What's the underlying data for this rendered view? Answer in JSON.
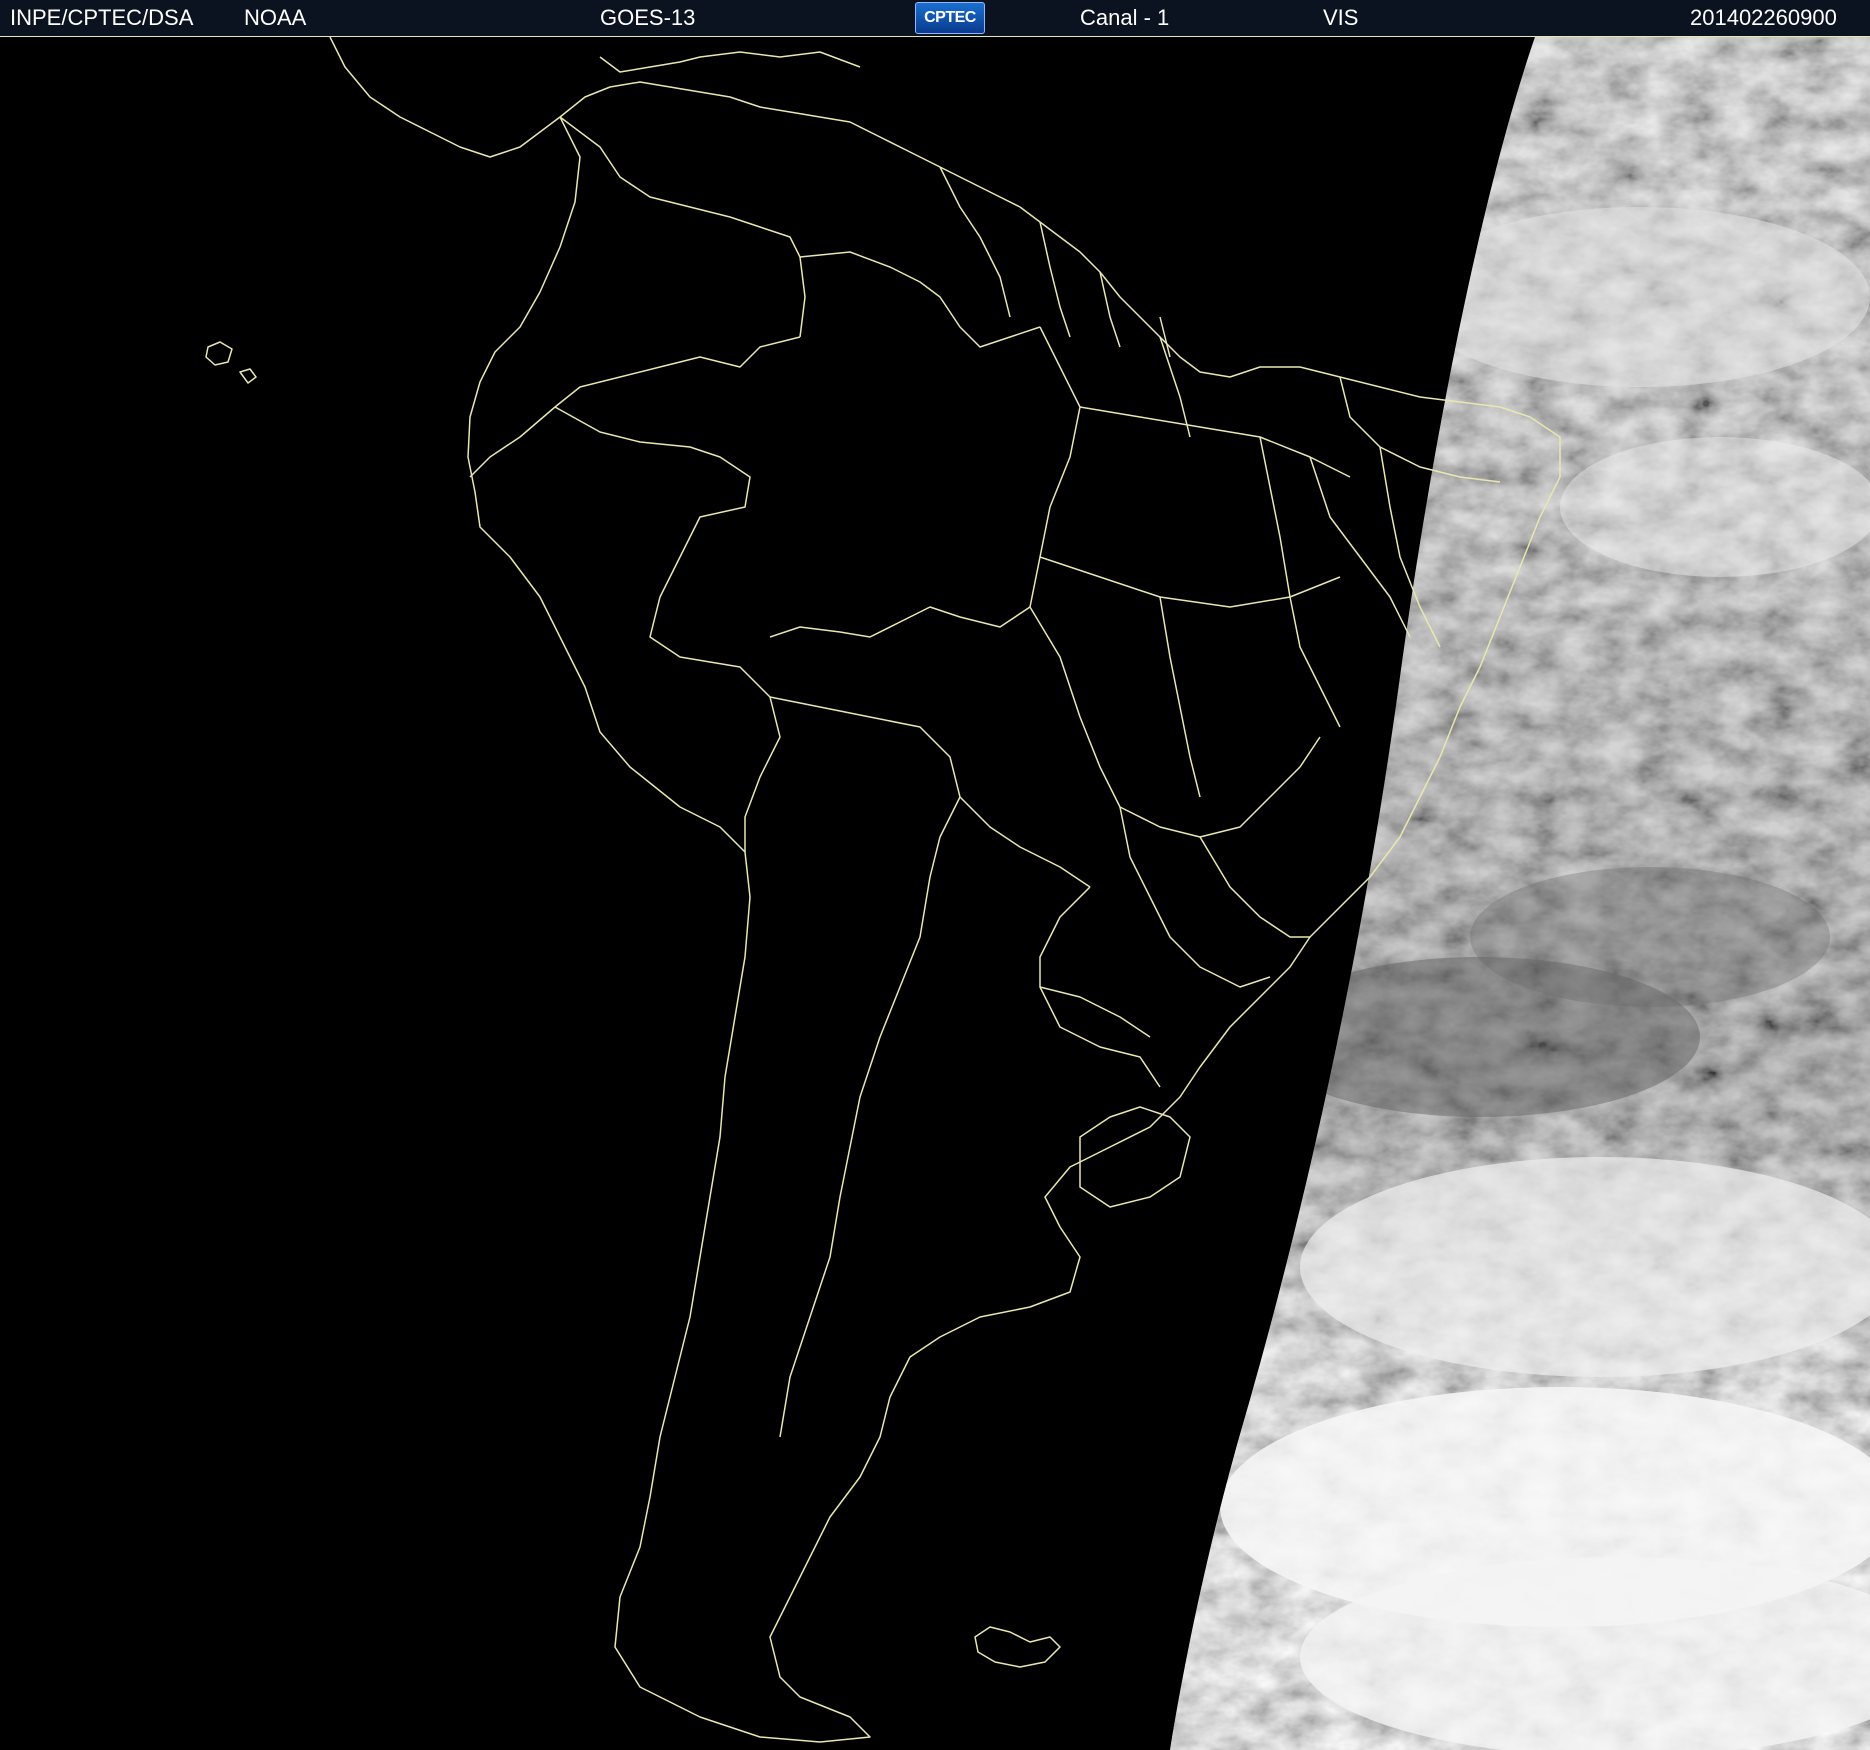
{
  "header": {
    "agency": "INPE/CPTEC/DSA",
    "source": "NOAA",
    "satellite": "GOES-13",
    "logo_text": "CPTEC",
    "channel": "Canal - 1",
    "band": "VIS",
    "timestamp": "201402260900"
  },
  "map": {
    "colors": {
      "background": "#000000",
      "borders": "#e9e7b0",
      "clouds_light": "#f2f2f2",
      "clouds_mid": "#9a9a9a",
      "clouds_dark": "#5a5a5a",
      "header_bg": "#0b1220"
    }
  }
}
